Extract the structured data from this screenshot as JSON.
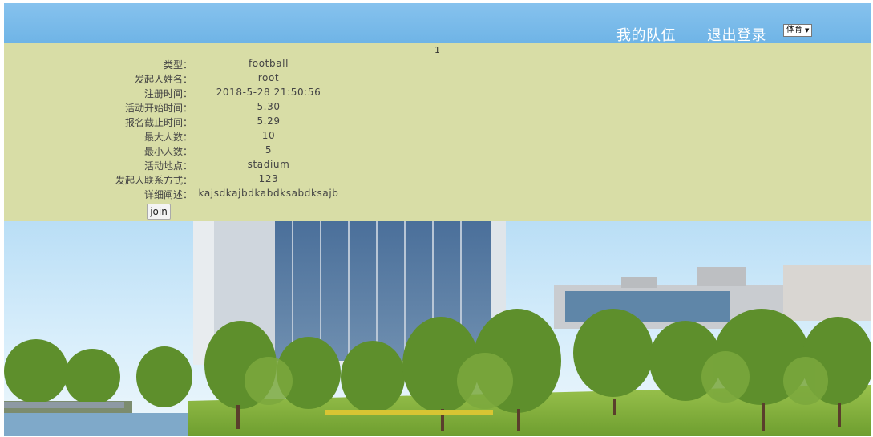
{
  "nav": {
    "my_team": "我的队伍",
    "logout": "退出登录",
    "category_selected": "体育"
  },
  "page_number": "1",
  "activity": {
    "fields": [
      {
        "label": "类型：",
        "value": "football"
      },
      {
        "label": "发起人姓名：",
        "value": "root"
      },
      {
        "label": "注册时间：",
        "value": "2018-5-28 21:50:56"
      },
      {
        "label": "活动开始时间：",
        "value": "5.30"
      },
      {
        "label": "报名截止时间：",
        "value": "5.29"
      },
      {
        "label": "最大人数：",
        "value": "10"
      },
      {
        "label": "最小人数：",
        "value": "5"
      },
      {
        "label": "活动地点：",
        "value": "stadium"
      },
      {
        "label": "发起人联系方式：",
        "value": "123"
      },
      {
        "label": "详细阐述：",
        "value": "kajsdkajbdkabdksabdksajb"
      }
    ],
    "join_label": "join"
  },
  "colors": {
    "header": "#75b8e8",
    "panel": "#d8dda6",
    "sky": "#c6e5f8",
    "grass": "#86b33e"
  }
}
